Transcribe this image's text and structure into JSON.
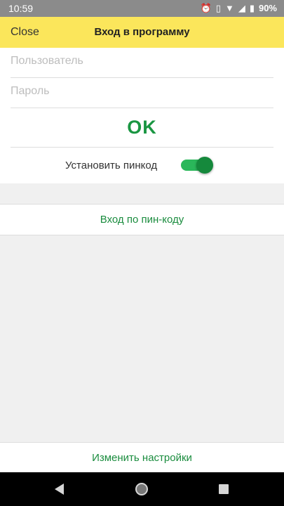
{
  "status_bar": {
    "time": "10:59",
    "battery": "90%",
    "icons": [
      "alarm-icon",
      "vibrate-icon",
      "wifi-icon",
      "signal-icon",
      "battery-icon"
    ]
  },
  "app_bar": {
    "close_label": "Close",
    "title": "Вход в программу"
  },
  "form": {
    "username_placeholder": "Пользователь",
    "username_value": "",
    "password_placeholder": "Пароль",
    "password_value": "",
    "ok_label": "OK",
    "pin_toggle_label": "Установить пинкод",
    "pin_toggle_on": true
  },
  "pin_login_label": "Вход по пин-коду",
  "settings_label": "Изменить настройки",
  "colors": {
    "app_bar": "#fbe65b",
    "accent_green": "#1a9642",
    "status_bar": "#8b8b8b"
  }
}
